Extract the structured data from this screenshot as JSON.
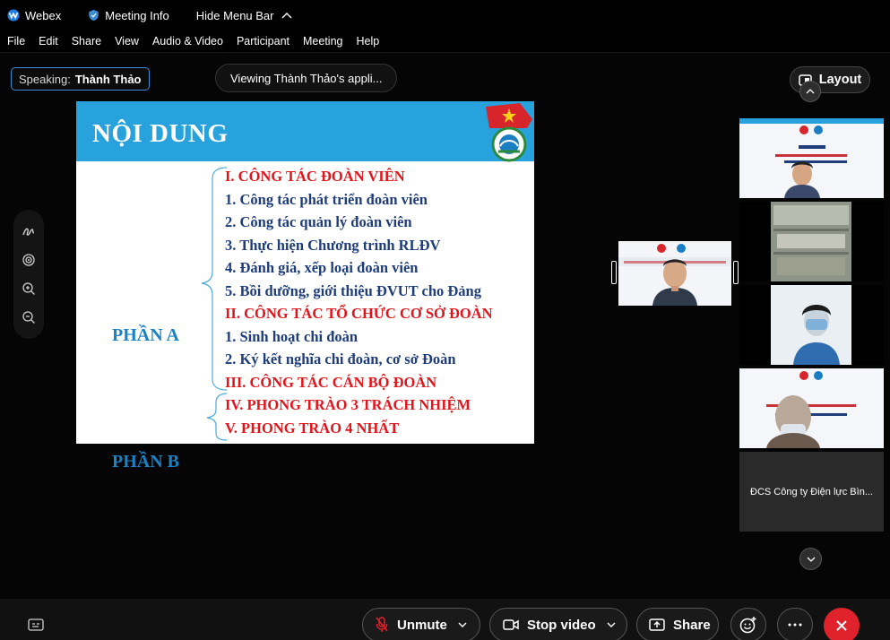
{
  "titlebar": {
    "app_name": "Webex",
    "meeting_info": "Meeting Info",
    "hide_menu": "Hide Menu Bar"
  },
  "menu": [
    "File",
    "Edit",
    "Share",
    "View",
    "Audio & Video",
    "Participant",
    "Meeting",
    "Help"
  ],
  "stage": {
    "speaking_label": "Speaking:",
    "speaking_name": "Thành Thảo",
    "viewing": "Viewing Thành Thảo's appli...",
    "layout_label": "Layout"
  },
  "slide": {
    "title": "NỘI DUNG",
    "part_a": "PHẦN A",
    "part_b": "PHẦN B",
    "lines": [
      {
        "text": "I. CÔNG TÁC ĐOÀN VIÊN",
        "color": "red"
      },
      {
        "text": "1. Công tác phát triển đoàn viên",
        "color": "blue"
      },
      {
        "text": "2. Công tác quản lý đoàn viên",
        "color": "blue"
      },
      {
        "text": "3. Thực hiện Chương trình RLĐV",
        "color": "blue"
      },
      {
        "text": "4. Đánh giá, xếp loại đoàn viên",
        "color": "blue"
      },
      {
        "text": "5. Bồi dưỡng, giới thiệu ĐVUT cho Đảng",
        "color": "blue"
      },
      {
        "text": "II. CÔNG TÁC TỔ CHỨC CƠ SỞ ĐOÀN",
        "color": "red"
      },
      {
        "text": "1. Sinh hoạt chi đoàn",
        "color": "blue"
      },
      {
        "text": "2. Ký kết nghĩa chi đoàn, cơ sở Đoàn",
        "color": "blue"
      },
      {
        "text": "III. CÔNG TÁC CÁN BỘ ĐOÀN",
        "color": "red"
      },
      {
        "text": "IV. PHONG TRÀO 3 TRÁCH NHIỆM",
        "color": "red"
      },
      {
        "text": "V. PHONG TRÀO 4 NHẤT",
        "color": "red"
      }
    ]
  },
  "participants": {
    "named_tile": "ĐCS Công ty Điện lực Bìn..."
  },
  "controls": {
    "mute_label": "Unmute",
    "video_label": "Stop video",
    "share_label": "Share"
  },
  "colors": {
    "accent": "#3b8bd6",
    "slide_header": "#27a2dd",
    "slide_red": "#e3141b",
    "slide_blue": "#1f3d7a",
    "part_blue": "#1a82c5",
    "end_call": "#e0222c"
  }
}
